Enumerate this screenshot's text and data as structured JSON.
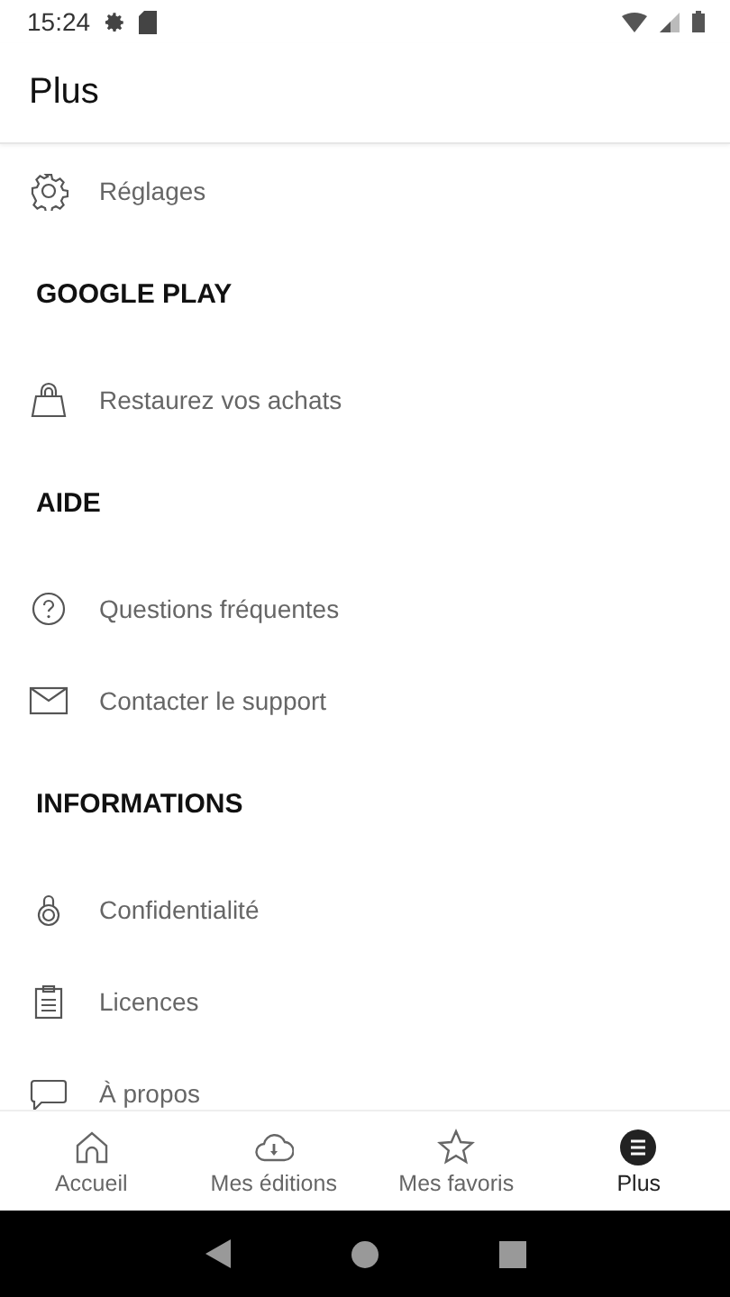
{
  "status_bar": {
    "time": "15:24"
  },
  "app_bar": {
    "title": "Plus"
  },
  "entries": [
    {
      "kind": "item",
      "label": "Réglages"
    },
    {
      "kind": "header",
      "label": "GOOGLE PLAY"
    },
    {
      "kind": "item",
      "label": "Restaurez vos achats"
    },
    {
      "kind": "header",
      "label": "AIDE"
    },
    {
      "kind": "item",
      "label": "Questions fréquentes"
    },
    {
      "kind": "item",
      "label": "Contacter le support"
    },
    {
      "kind": "header",
      "label": "INFORMATIONS"
    },
    {
      "kind": "item",
      "label": "Confidentialité"
    },
    {
      "kind": "item",
      "label": "Licences"
    },
    {
      "kind": "item",
      "label": "À propos"
    }
  ],
  "bottom_nav": [
    {
      "label": "Accueil",
      "selected": false
    },
    {
      "label": "Mes éditions",
      "selected": false
    },
    {
      "label": "Mes favoris",
      "selected": false
    },
    {
      "label": "Plus",
      "selected": true
    }
  ]
}
